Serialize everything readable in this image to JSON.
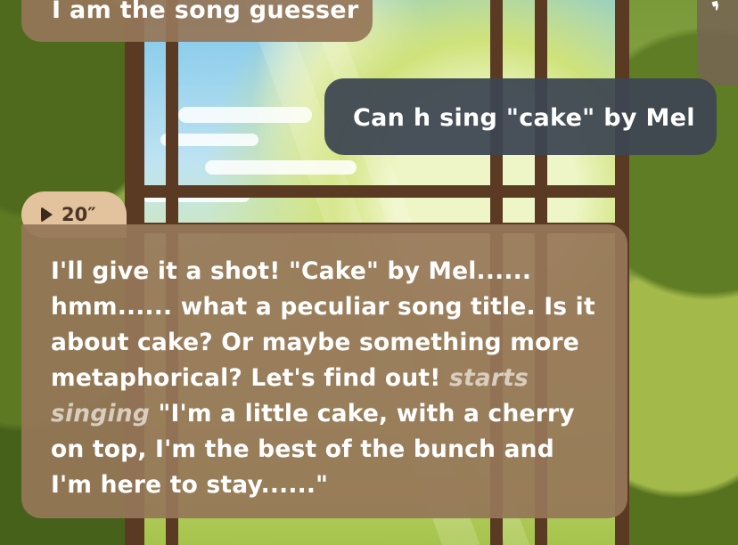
{
  "messages": {
    "top_ai": {
      "text": "I am the song guesser"
    },
    "user": {
      "text": "Can h sing \"cake\" by Mel"
    },
    "voice": {
      "duration": "20″",
      "icon": "play-icon"
    },
    "ai_reply": {
      "part1": "I'll give it a shot! \"Cake\" by Mel...... hmm...... what a peculiar song title. Is it about cake? Or maybe something more metaphorical? Let's find out! ",
      "action": "starts singing",
      "part2": " \"I'm a little cake, with a cherry on top, I'm the best of the bunch and I'm here to stay......\""
    }
  },
  "colors": {
    "ai_bubble": "#96765a",
    "user_bubble": "#3e4652",
    "voice_pill": "#e3c39d",
    "action_text": "#d9cdbf"
  }
}
